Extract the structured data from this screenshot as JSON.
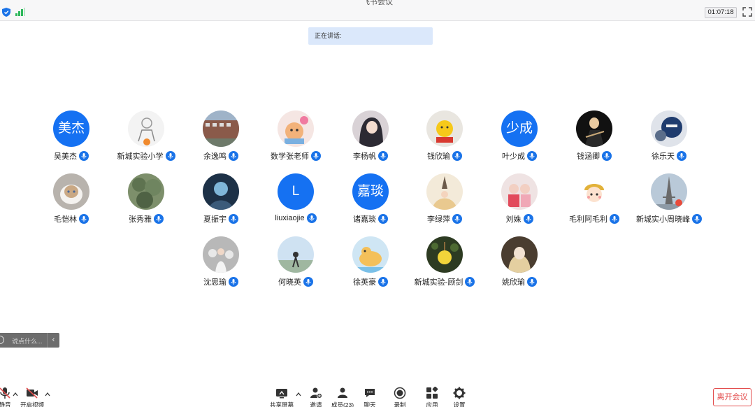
{
  "window": {
    "title": "飞书会议"
  },
  "header": {
    "timer": "01:07:18"
  },
  "speaking": {
    "label": "正在讲话:"
  },
  "participants": [
    {
      "name": "吴美杰",
      "initials": "美杰"
    },
    {
      "name": "新城实验小学",
      "initials": ""
    },
    {
      "name": "余逸鸣",
      "initials": ""
    },
    {
      "name": "数学张老师",
      "initials": ""
    },
    {
      "name": "李杨帆",
      "initials": ""
    },
    {
      "name": "钱欣瑜",
      "initials": ""
    },
    {
      "name": "叶少成",
      "initials": "少成"
    },
    {
      "name": "钱涵卿",
      "initials": ""
    },
    {
      "name": "徐乐天",
      "initials": ""
    },
    {
      "name": "毛恺林",
      "initials": ""
    },
    {
      "name": "张秀雅",
      "initials": ""
    },
    {
      "name": "夏振宇",
      "initials": ""
    },
    {
      "name": "liuxiaojie",
      "initials": "L"
    },
    {
      "name": "诸嘉琰",
      "initials": "嘉琰"
    },
    {
      "name": "李绿萍",
      "initials": ""
    },
    {
      "name": "刘姝",
      "initials": ""
    },
    {
      "name": "毛利阿毛利",
      "initials": ""
    },
    {
      "name": "新城实小周晓峰",
      "initials": ""
    },
    {
      "name": "沈思瑜",
      "initials": ""
    },
    {
      "name": "何晓英",
      "initials": ""
    },
    {
      "name": "徐英豪",
      "initials": ""
    },
    {
      "name": "新城实验-顾剑",
      "initials": ""
    },
    {
      "name": "姚欣瑜",
      "initials": ""
    }
  ],
  "chat": {
    "placeholder": "说点什么..."
  },
  "toolbar": {
    "mute_label": "静音",
    "video_label": "开启视频",
    "share_label": "共享屏幕",
    "invite_label": "邀请",
    "members_label": "成员(23)",
    "chat_label": "聊天",
    "record_label": "录制",
    "apps_label": "应用",
    "settings_label": "设置",
    "leave_label": "离开会议"
  },
  "colors": {
    "accent": "#1571f2",
    "leave": "#e34d4d"
  }
}
